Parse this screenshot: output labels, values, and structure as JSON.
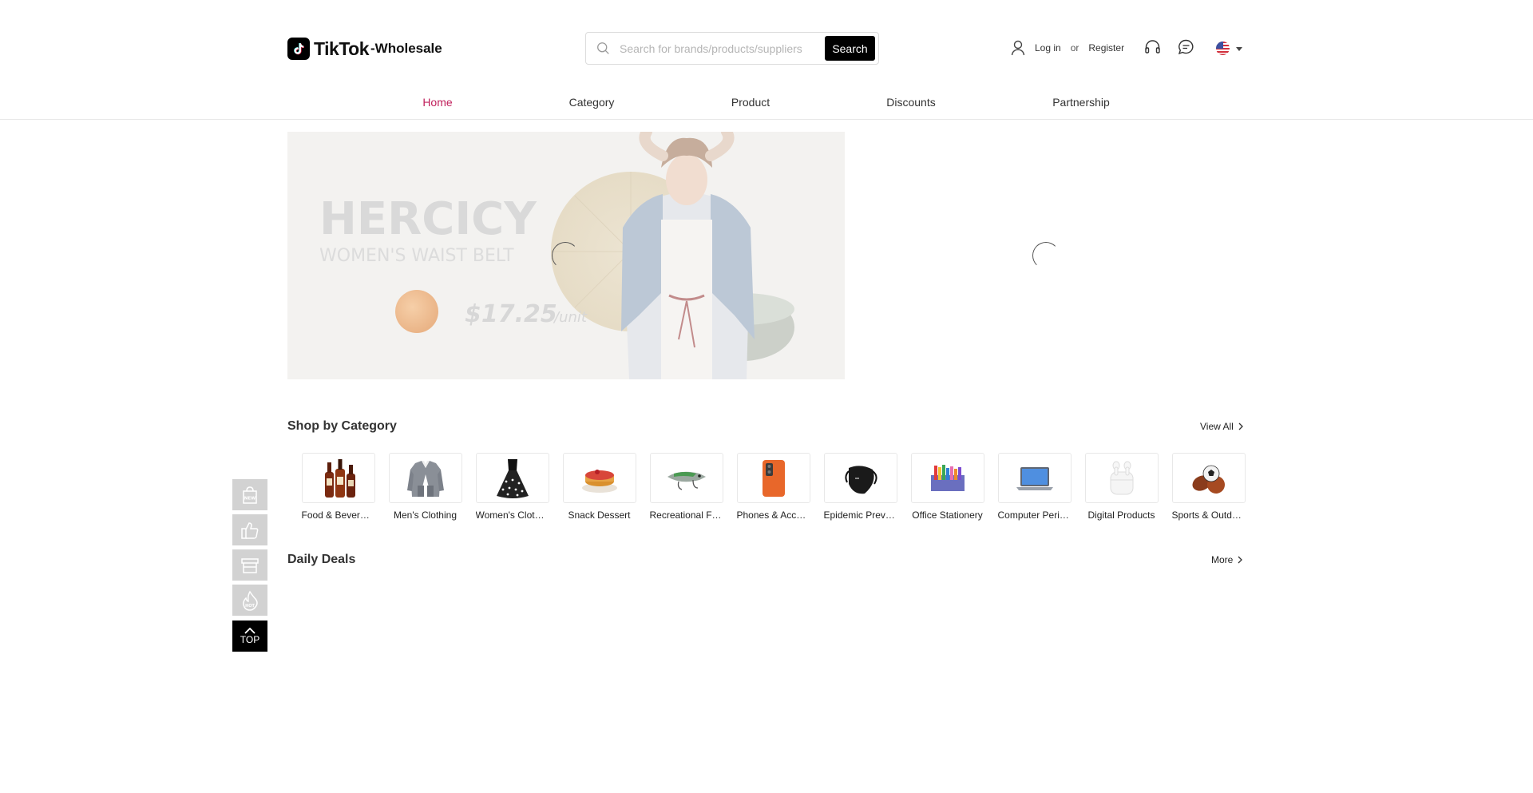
{
  "header": {
    "logo_brand": "TikTok",
    "logo_suffix": "-Wholesale",
    "search": {
      "placeholder": "Search for brands/products/suppliers",
      "button_label": "Search"
    },
    "user": {
      "login": "Log in",
      "or": "or",
      "register": "Register"
    },
    "icons": [
      "user-icon",
      "headset-icon",
      "chat-icon",
      "us-flag-icon"
    ]
  },
  "nav": {
    "items": [
      {
        "label": "Home",
        "active": true
      },
      {
        "label": "Category",
        "active": false
      },
      {
        "label": "Product",
        "active": false
      },
      {
        "label": "Discounts",
        "active": false
      },
      {
        "label": "Partnership",
        "active": false
      }
    ]
  },
  "banner": {
    "brand": "HERCICY",
    "product": "WOMEN'S WAIST BELT",
    "price": "$17.25",
    "unit": "/unit"
  },
  "shop_by_category": {
    "title": "Shop by Category",
    "view_all": "View All",
    "items": [
      {
        "label": "Food & Beverages",
        "icon": "liquor-bottles-icon"
      },
      {
        "label": "Men's Clothing",
        "icon": "suit-icon"
      },
      {
        "label": "Women's Clothing",
        "icon": "dress-icon"
      },
      {
        "label": "Snack Dessert",
        "icon": "cake-icon"
      },
      {
        "label": "Recreational Fishing",
        "icon": "fishing-lure-icon"
      },
      {
        "label": "Phones & Accessories",
        "icon": "phone-icon"
      },
      {
        "label": "Epidemic Prevention",
        "icon": "face-mask-icon"
      },
      {
        "label": "Office Stationery",
        "icon": "stationery-icon"
      },
      {
        "label": "Computer Peripherals",
        "icon": "laptop-icon"
      },
      {
        "label": "Digital Products",
        "icon": "earbuds-icon"
      },
      {
        "label": "Sports & Outdoors",
        "icon": "sports-balls-icon"
      }
    ]
  },
  "daily_deals": {
    "title": "Daily Deals",
    "more": "More"
  },
  "side_toolbar": {
    "items": [
      "new-icon",
      "thumbs-up-icon",
      "store-icon",
      "hot-icon"
    ],
    "top_label": "TOP"
  },
  "colors": {
    "accent": "#c01f5b",
    "dark": "#000000"
  }
}
